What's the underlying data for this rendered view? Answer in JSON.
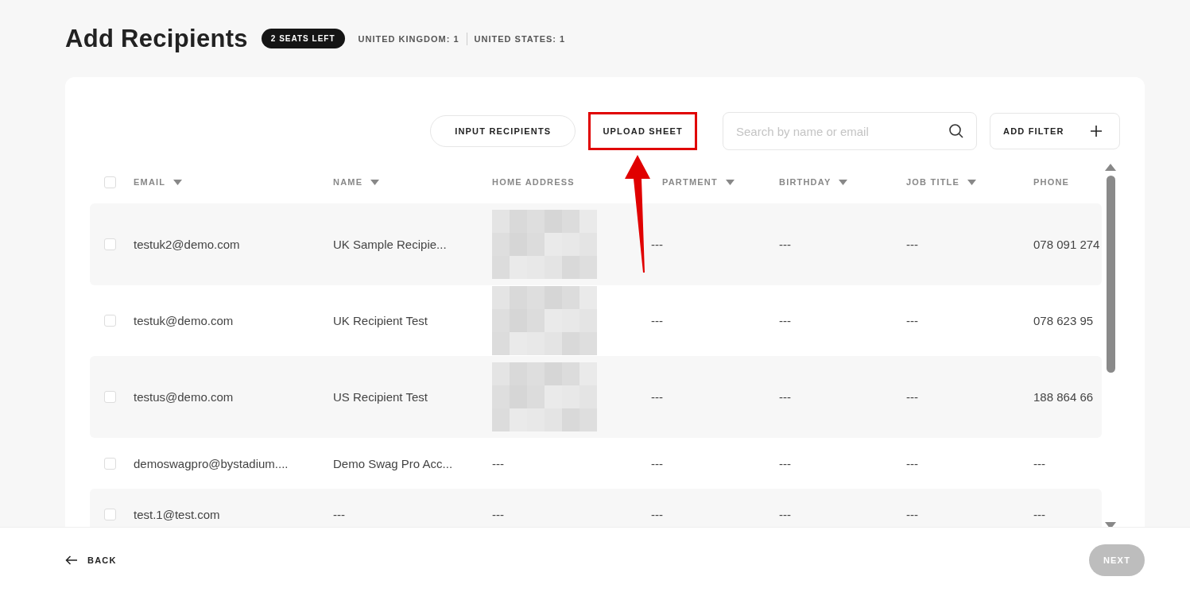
{
  "title": "Add Recipients",
  "seats_badge": "2 SEATS LEFT",
  "counts": [
    "UNITED KINGDOM: 1",
    "UNITED STATES: 1"
  ],
  "toolbar": {
    "buttons": [
      {
        "label": "INPUT RECIPIENTS",
        "highlighted": false
      },
      {
        "label": "UPLOAD SHEET",
        "highlighted": true
      }
    ],
    "search": {
      "placeholder": "Search by name or email"
    },
    "filter": {
      "label": "ADD FILTER"
    }
  },
  "annotation_arrow": true,
  "table": {
    "select_all": {
      "checked": false
    },
    "columns": [
      {
        "label": "EMAIL",
        "sortable": true
      },
      {
        "label": "NAME",
        "sortable": true
      },
      {
        "label": "HOME ADDRESS",
        "sortable": false
      },
      {
        "label": "PARTMENT",
        "sortable": true
      },
      {
        "label": "BIRTHDAY",
        "sortable": true
      },
      {
        "label": "JOB TITLE",
        "sortable": true
      },
      {
        "label": "PHONE",
        "sortable": false
      }
    ],
    "rows": [
      {
        "checked": false,
        "cells": [
          {
            "kind": "text",
            "text": "testuk2@demo.com"
          },
          {
            "kind": "text",
            "text": "UK Sample Recipie..."
          },
          {
            "kind": "redacted"
          },
          {
            "kind": "text",
            "text": "---"
          },
          {
            "kind": "text",
            "text": "---"
          },
          {
            "kind": "text",
            "text": "---"
          },
          {
            "kind": "text",
            "text": "078 091 274"
          }
        ]
      },
      {
        "checked": false,
        "cells": [
          {
            "kind": "text",
            "text": "testuk@demo.com"
          },
          {
            "kind": "text",
            "text": "UK Recipient Test"
          },
          {
            "kind": "redacted"
          },
          {
            "kind": "text",
            "text": "---"
          },
          {
            "kind": "text",
            "text": "---"
          },
          {
            "kind": "text",
            "text": "---"
          },
          {
            "kind": "text",
            "text": "078 623 95"
          }
        ]
      },
      {
        "checked": false,
        "cells": [
          {
            "kind": "text",
            "text": "testus@demo.com"
          },
          {
            "kind": "text",
            "text": "US Recipient Test"
          },
          {
            "kind": "redacted"
          },
          {
            "kind": "text",
            "text": "---"
          },
          {
            "kind": "text",
            "text": "---"
          },
          {
            "kind": "text",
            "text": "---"
          },
          {
            "kind": "text",
            "text": "188 864 66"
          }
        ]
      },
      {
        "checked": false,
        "cells": [
          {
            "kind": "text",
            "text": "demoswagpro@bystadium...."
          },
          {
            "kind": "text",
            "text": "Demo Swag Pro Acc..."
          },
          {
            "kind": "text",
            "text": "---"
          },
          {
            "kind": "text",
            "text": "---"
          },
          {
            "kind": "text",
            "text": "---"
          },
          {
            "kind": "text",
            "text": "---"
          },
          {
            "kind": "text",
            "text": "---"
          }
        ]
      },
      {
        "checked": false,
        "cells": [
          {
            "kind": "text",
            "text": "test.1@test.com"
          },
          {
            "kind": "text",
            "text": "---"
          },
          {
            "kind": "text",
            "text": "---"
          },
          {
            "kind": "text",
            "text": "---"
          },
          {
            "kind": "text",
            "text": "---"
          },
          {
            "kind": "text",
            "text": "---"
          },
          {
            "kind": "text",
            "text": "---"
          }
        ]
      }
    ]
  },
  "footer": {
    "back": {
      "label": "BACK"
    },
    "next": {
      "label": "NEXT",
      "disabled": true
    }
  }
}
